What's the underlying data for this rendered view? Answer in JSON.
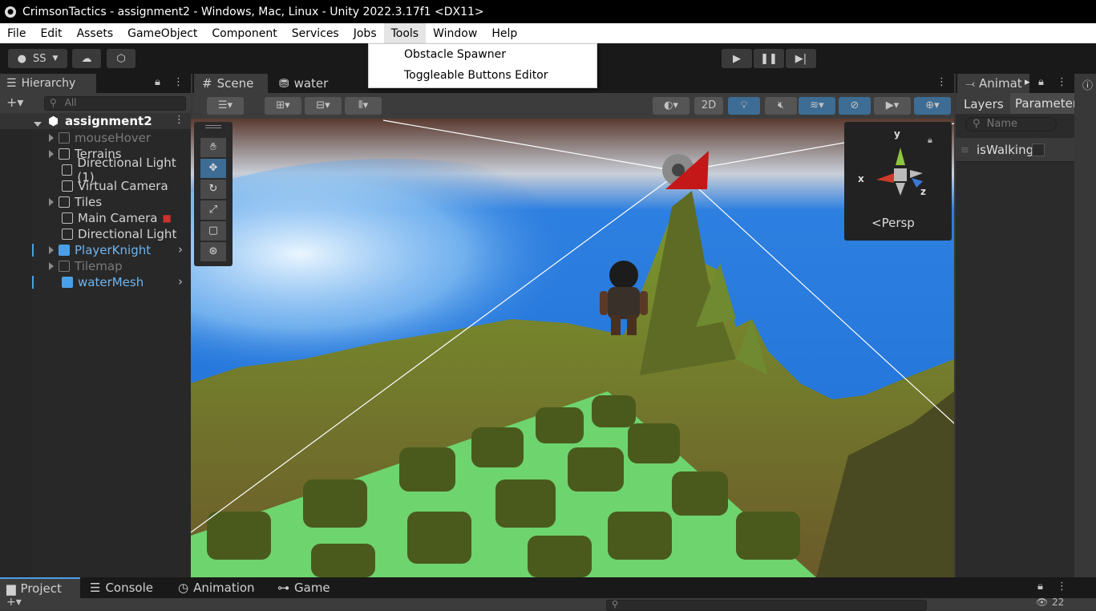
{
  "window": {
    "title": "CrimsonTactics - assignment2 - Windows, Mac, Linux - Unity 2022.3.17f1 <DX11>"
  },
  "menu": [
    "File",
    "Edit",
    "Assets",
    "GameObject",
    "Component",
    "Services",
    "Jobs",
    "Tools",
    "Window",
    "Help"
  ],
  "tools_menu": {
    "items": [
      "Obstacle Spawner",
      "Toggleable Buttons Editor"
    ]
  },
  "toolbar": {
    "account": "SS"
  },
  "hierarchy": {
    "tab": "Hierarchy",
    "search_placeholder": "All",
    "scene": "assignment2",
    "items": [
      {
        "label": "mouseHover"
      },
      {
        "label": "Terrains"
      },
      {
        "label": "Directional Light (1)"
      },
      {
        "label": "Virtual Camera"
      },
      {
        "label": "Tiles"
      },
      {
        "label": "Main Camera"
      },
      {
        "label": "Directional Light"
      },
      {
        "label": "PlayerKnight"
      },
      {
        "label": "Tilemap"
      },
      {
        "label": "waterMesh"
      }
    ]
  },
  "scene": {
    "tabs": [
      "Scene",
      "water"
    ],
    "mode_2d": "2D",
    "gizmo": {
      "x": "x",
      "y": "y",
      "z": "z",
      "persp": "Persp"
    }
  },
  "animator": {
    "tab": "Animat",
    "subtabs": [
      "Layers",
      "Parameter"
    ],
    "search_placeholder": "Name",
    "param": "isWalking"
  },
  "bottom": {
    "tabs": [
      "Project",
      "Console",
      "Animation",
      "Game"
    ],
    "hidden_count": "22"
  },
  "colors": {
    "accent_blue": "#4aa0e8",
    "selected": "#2c5d87"
  }
}
